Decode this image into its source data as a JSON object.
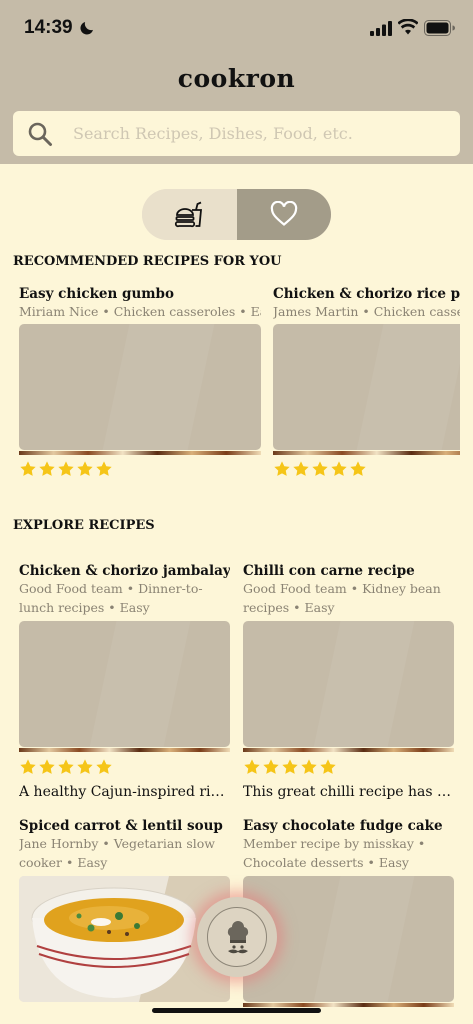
{
  "status": {
    "time": "14:39"
  },
  "app": {
    "title": "cookron"
  },
  "search": {
    "placeholder": "Search Recipes, Dishes, Food, etc."
  },
  "toggle": {
    "food_icon": "food-icon",
    "favorite_icon": "heart-icon"
  },
  "recommended": {
    "title": "RECOMMENDED RECIPES FOR YOU",
    "items": [
      {
        "title": "Easy chicken gumbo",
        "meta": "Miriam Nice • Chicken casseroles • Easy",
        "rating": 5
      },
      {
        "title": "Chicken & chorizo rice pot",
        "meta": "James Martin • Chicken casseroles • Easy",
        "rating": 5
      }
    ]
  },
  "explore": {
    "title": "EXPLORE RECIPES",
    "items": [
      {
        "title": "Chicken & chorizo jambalaya",
        "meta": "Good Food team • Dinner-to-lunch recipes • Easy",
        "rating": 5,
        "desc": "A healthy Cajun-inspired rice pot recipe that's bursting with flavour"
      },
      {
        "title": "Chilli con carne recipe",
        "meta": "Good Food team • Kidney bean recipes • Easy",
        "rating": 5,
        "desc": "This great chilli recipe has to be one of the best"
      },
      {
        "title": "Spiced carrot & lentil soup",
        "meta": "Jane Hornby • Vegetarian slow cooker • Easy"
      },
      {
        "title": "Easy chocolate fudge cake",
        "meta": "Member recipe by misskay • Chocolate desserts • Easy"
      }
    ]
  },
  "colors": {
    "header": "#c5bba8",
    "background": "#fdf6d8",
    "star": "#f5c518",
    "toggle_active": "#a39c89"
  }
}
